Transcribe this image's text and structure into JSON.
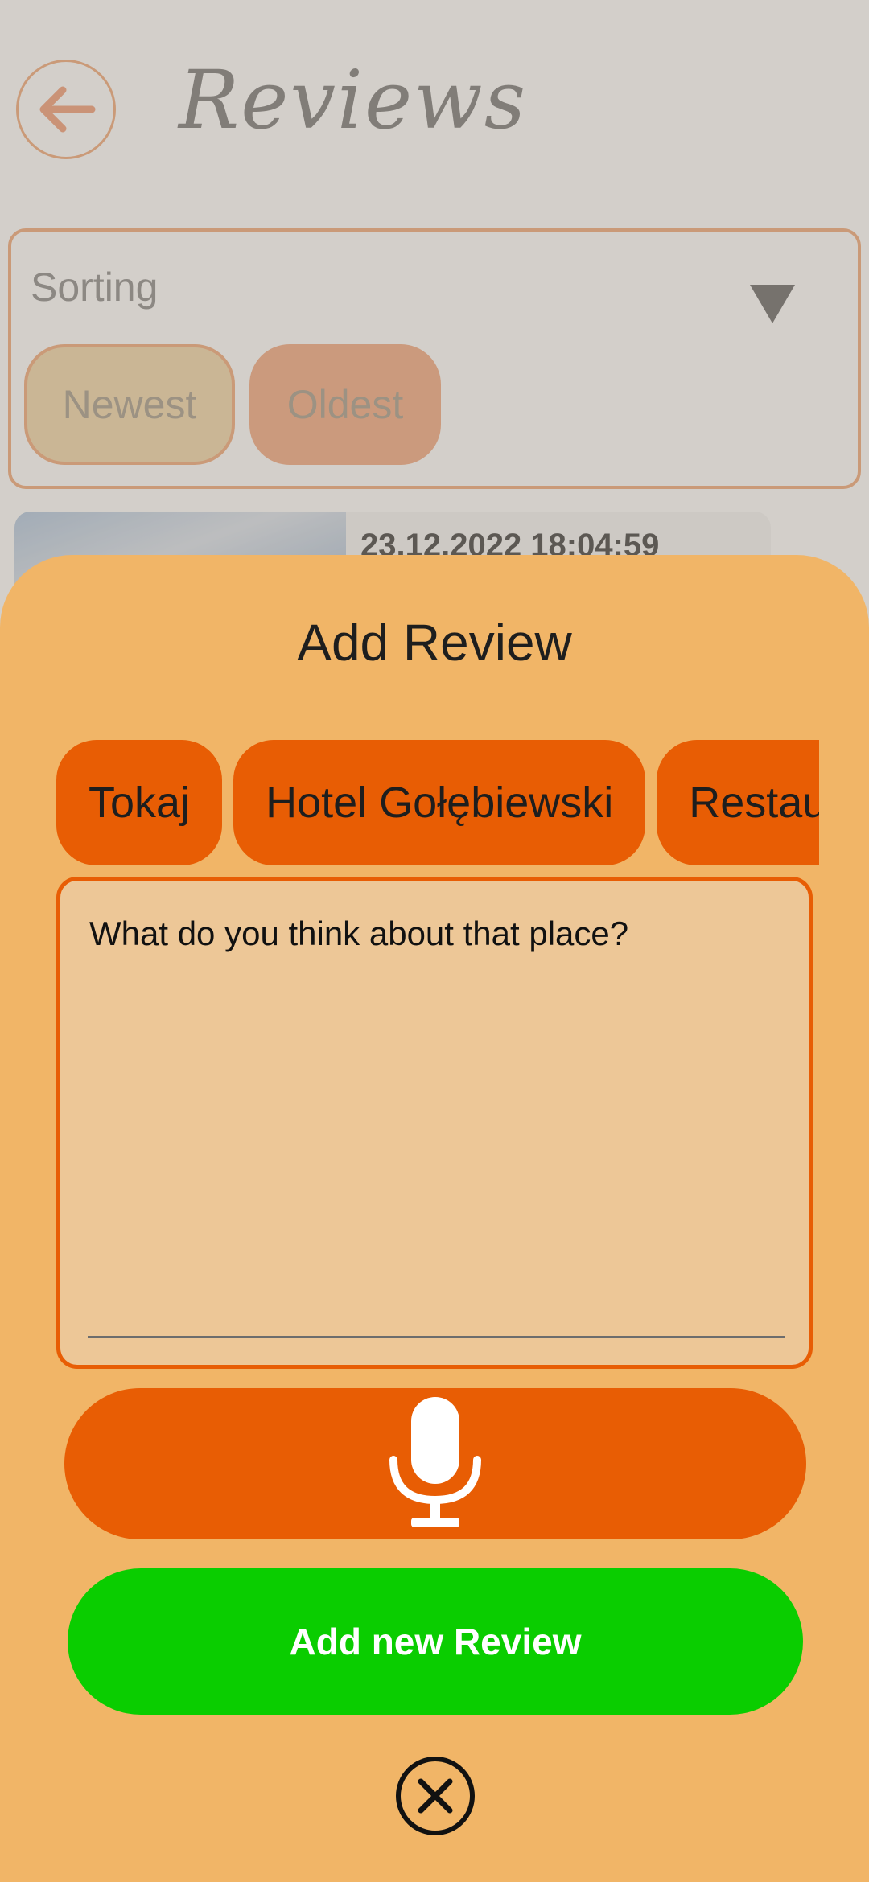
{
  "background_page": {
    "title": "Reviews",
    "sorting": {
      "label": "Sorting",
      "options": [
        "Newest",
        "Oldest"
      ],
      "selected": "Newest"
    },
    "first_review": {
      "date": "23.12.2022 18:04:59"
    },
    "icons": {
      "back": "arrow-left-icon",
      "dropdown": "triangle-down-icon"
    }
  },
  "sheet": {
    "title": "Add Review",
    "places": [
      "Tokaj",
      "Hotel Gołębiewski",
      "Restau"
    ],
    "review_input": {
      "placeholder": "What do you think about that place?",
      "value": ""
    },
    "mic_icon": "microphone-icon",
    "add_button_label": "Add new Review",
    "close_icon": "close-circle-icon"
  },
  "colors": {
    "sheet_background": "#f1b567",
    "accent_orange": "#e85d04",
    "input_background": "#edc797",
    "add_button": "#0acd00"
  }
}
